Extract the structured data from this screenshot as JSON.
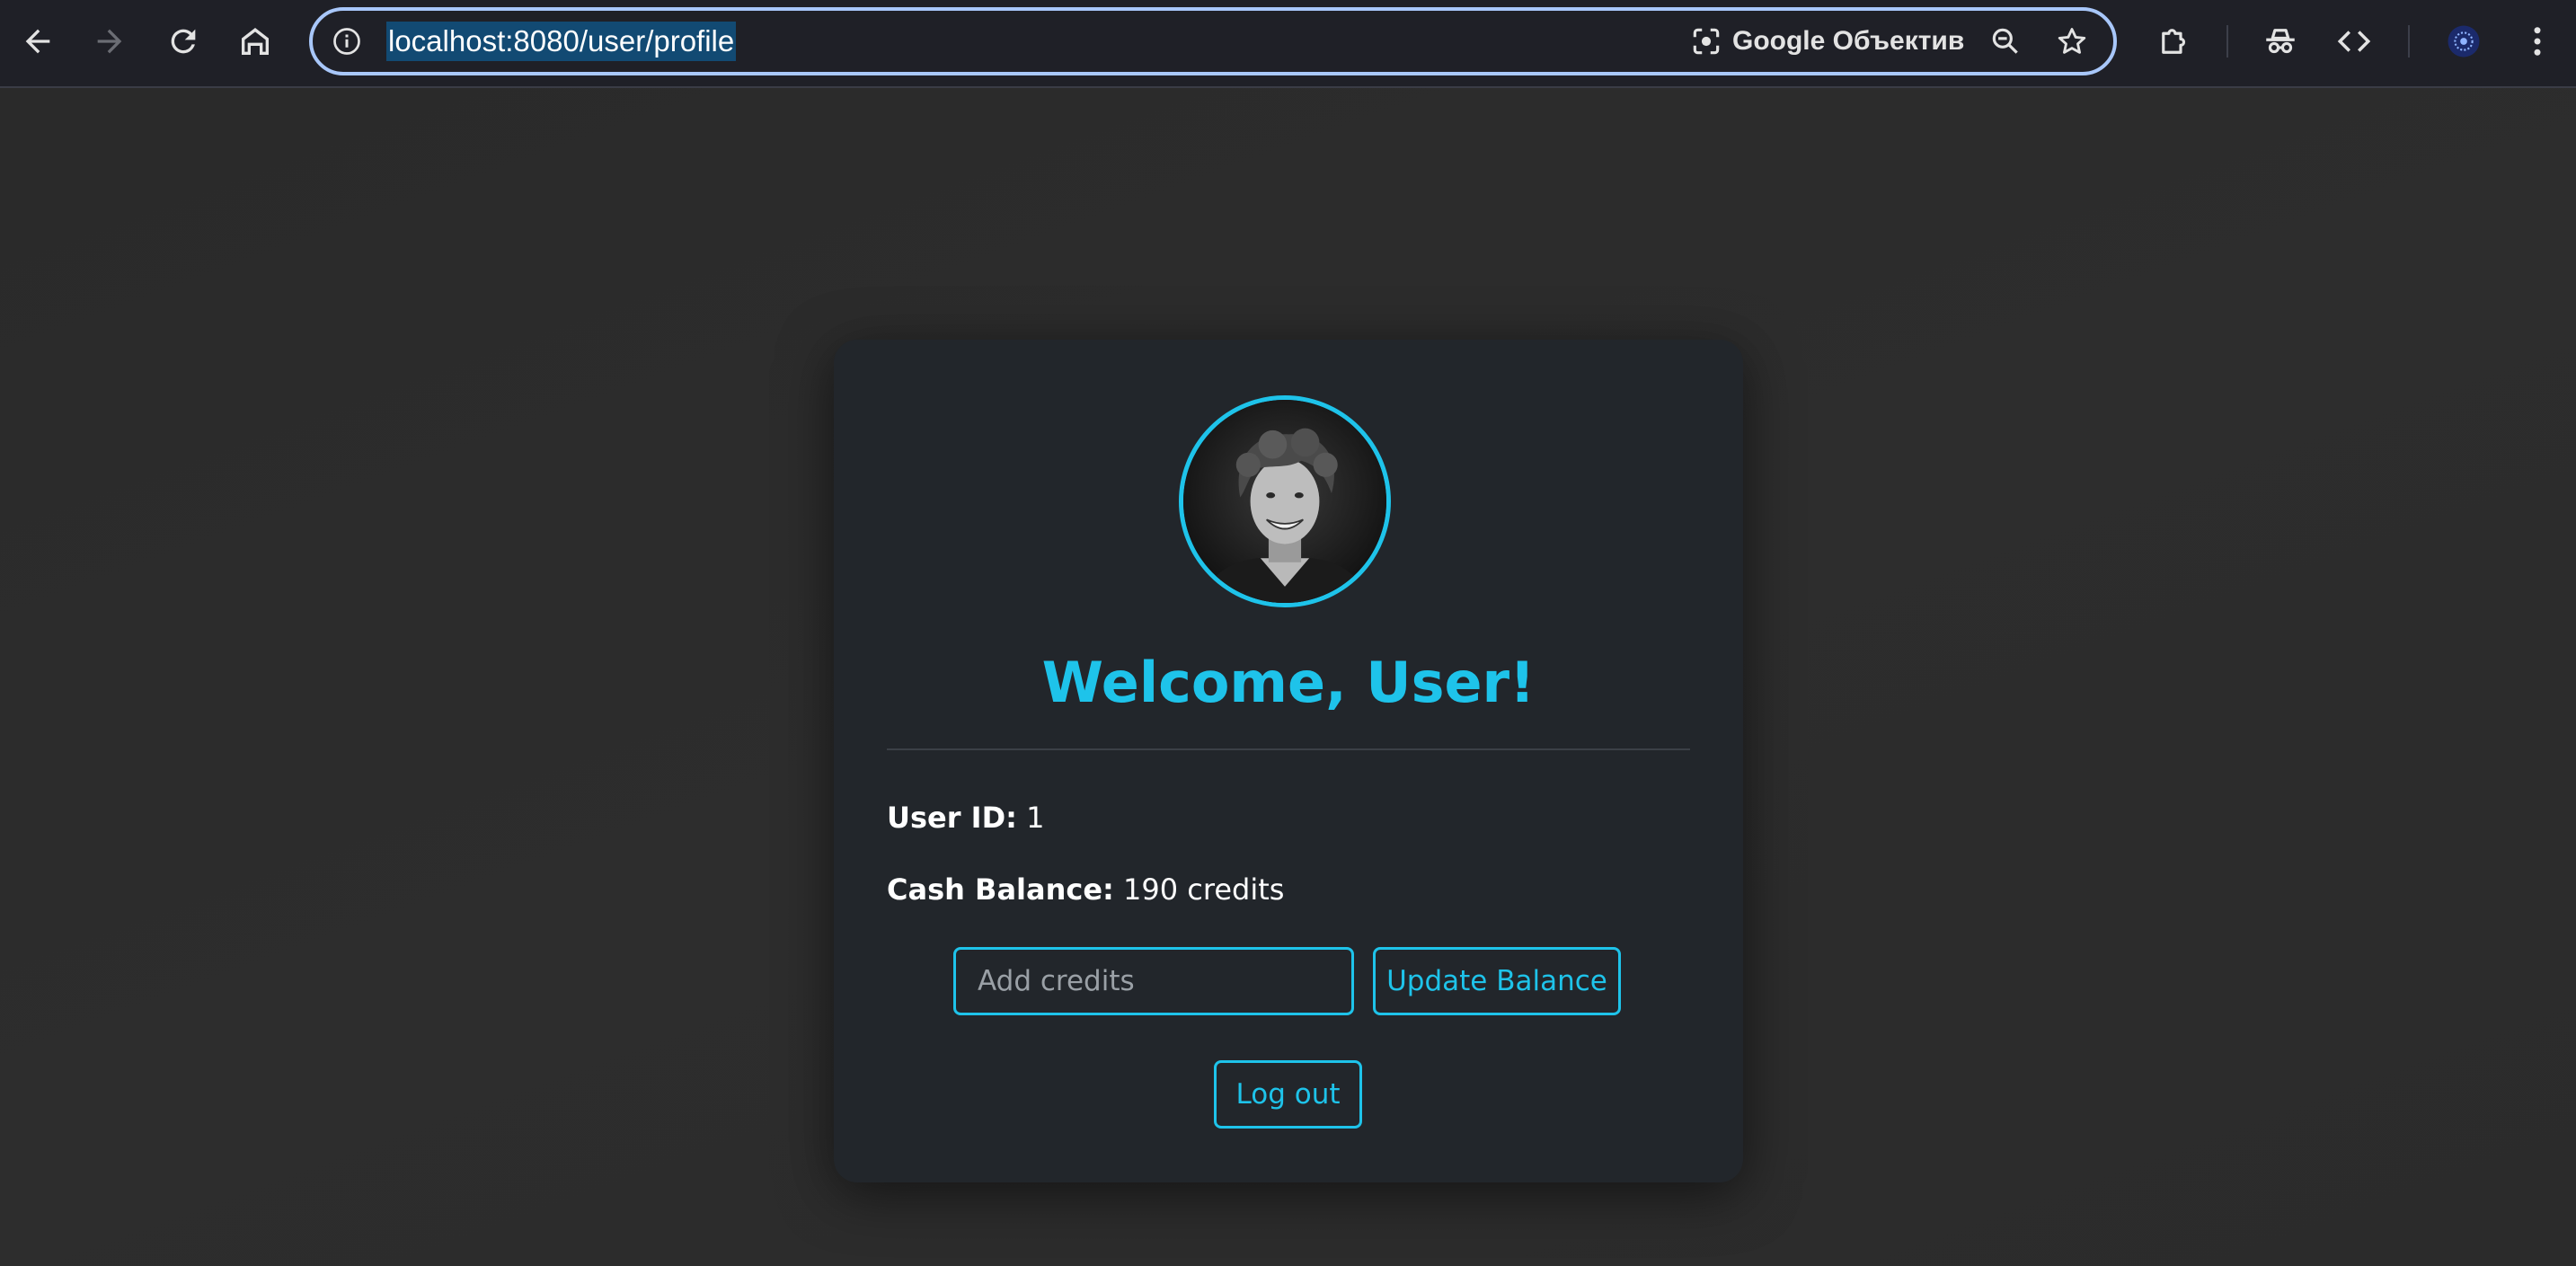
{
  "browser": {
    "url": "localhost:8080/user/profile",
    "lens_label": "Google Объектив",
    "icons": {
      "back": "arrow-left-icon",
      "forward": "arrow-right-icon",
      "reload": "reload-icon",
      "home": "home-icon",
      "site_info": "info-icon",
      "lens": "google-lens-icon",
      "zoom": "zoom-out-icon",
      "bookmark": "star-icon",
      "extensions": "puzzle-icon",
      "incognito": "incognito-icon",
      "devtools": "code-icon",
      "profile": "profile-avatar-icon",
      "menu": "kebab-menu-icon"
    },
    "accent_color": "#a8c7fa"
  },
  "profile": {
    "welcome": "Welcome, User!",
    "user_id_label": "User ID:",
    "user_id_value": "1",
    "balance_label": "Cash Balance:",
    "balance_value": "190 credits",
    "credits_placeholder": "Add credits",
    "update_button": "Update Balance",
    "logout_button": "Log out",
    "accent_color": "#1ec3ea"
  }
}
